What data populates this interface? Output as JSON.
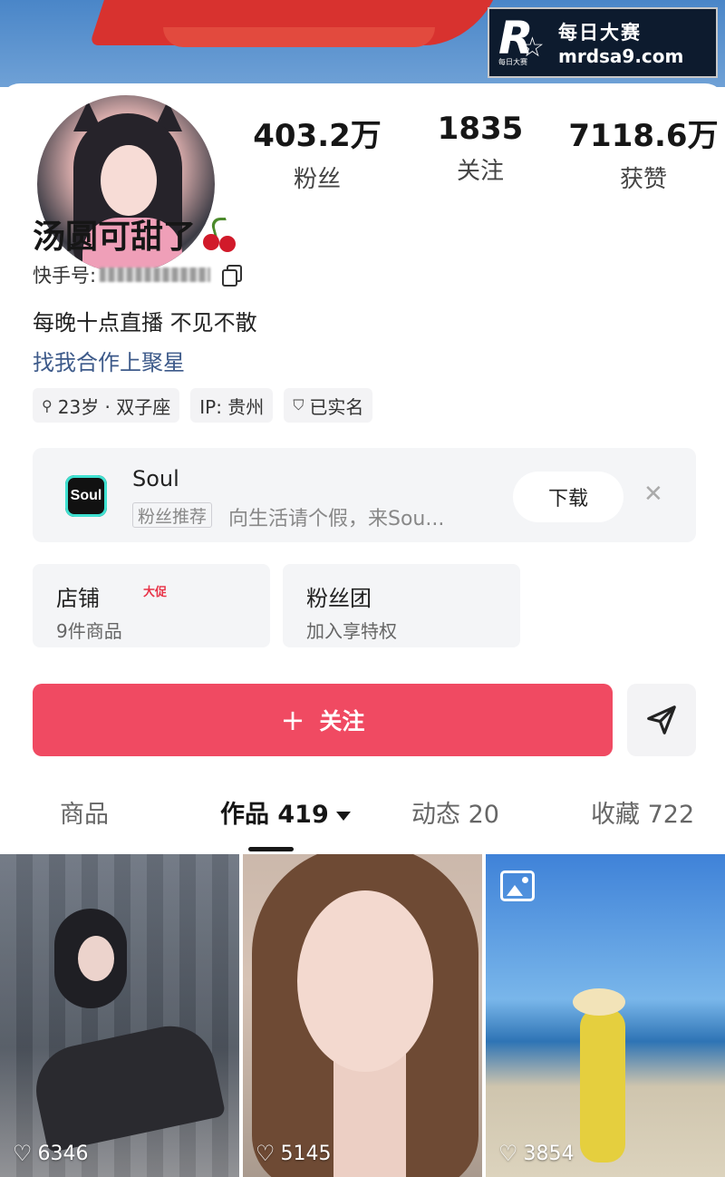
{
  "watermark": {
    "logo_letter": "R",
    "logo_sub": "每日大赛",
    "brand": "每日大赛",
    "url": "mrdsa9.com"
  },
  "profile": {
    "nickname": "汤圆可甜了",
    "nickname_emoji": "cherry-emoji",
    "id_label": "快手号:",
    "bio": "每晚十点直播 不见不散",
    "collab_link": "找我合作上聚星"
  },
  "stats": [
    {
      "value": "403.2万",
      "label": "粉丝"
    },
    {
      "value": "1835",
      "label": "关注"
    },
    {
      "value": "7118.6万",
      "label": "获赞"
    }
  ],
  "tags": [
    {
      "icon": "⚲",
      "label": "23岁 · 双子座"
    },
    {
      "icon": "",
      "label": "IP: 贵州"
    },
    {
      "icon": "⛉",
      "label": "已实名"
    }
  ],
  "ad": {
    "logo_text": "Soul",
    "name": "Soul",
    "badge": "粉丝推荐",
    "description": "向生活请个假，来Sou...",
    "download_label": "下载",
    "close_symbol": "✕"
  },
  "shop": {
    "title": "店铺",
    "promo": "大促",
    "subtitle": "9件商品"
  },
  "fan_club": {
    "title": "粉丝团",
    "subtitle": "加入享特权"
  },
  "actions": {
    "follow_plus": "+",
    "follow_label": "关注"
  },
  "tabs": [
    {
      "label": "商品",
      "active": false
    },
    {
      "label": "作品 419",
      "active": true
    },
    {
      "label": "动态 20",
      "active": false
    },
    {
      "label": "收藏 722",
      "active": false
    }
  ],
  "posts": [
    {
      "likes": "6346",
      "type": "video"
    },
    {
      "likes": "5145",
      "type": "video"
    },
    {
      "likes": "3854",
      "type": "image-set"
    }
  ],
  "colors": {
    "follow": "#f04a62",
    "link": "#3d5a8a",
    "promo": "#e83348"
  }
}
